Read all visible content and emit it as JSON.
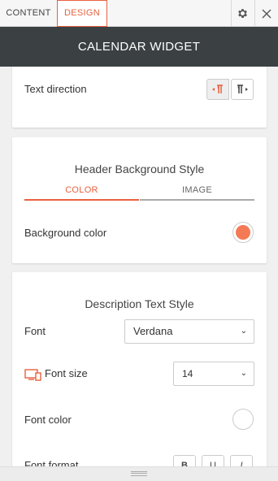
{
  "tabs": {
    "content": "CONTENT",
    "design": "DESIGN",
    "active": "design"
  },
  "header": {
    "title": "CALENDAR WIDGET"
  },
  "text_direction": {
    "label": "Text direction",
    "options": [
      "ltr",
      "rtl"
    ],
    "selected": "ltr"
  },
  "header_bg": {
    "title": "Header Background Style",
    "tabs": {
      "color": "COLOR",
      "image": "IMAGE",
      "active": "color"
    },
    "bg_color_label": "Background color",
    "bg_color": "#f47a55"
  },
  "description": {
    "title": "Description Text Style",
    "font_label": "Font",
    "font_value": "Verdana",
    "font_size_label": "Font size",
    "font_size_value": "14",
    "font_color_label": "Font color",
    "font_color": "#ffffff",
    "font_format_label": "Font format",
    "format_buttons": [
      "B",
      "U",
      "I"
    ]
  },
  "colors": {
    "accent": "#e8613e",
    "titlebar": "#3b4043"
  },
  "icons": {
    "gear": "gear-icon",
    "close": "close-icon",
    "ltr": "text-direction-ltr-icon",
    "rtl": "text-direction-rtl-icon",
    "device": "desktop-mobile-icon",
    "chevron": "chevron-down-icon"
  }
}
